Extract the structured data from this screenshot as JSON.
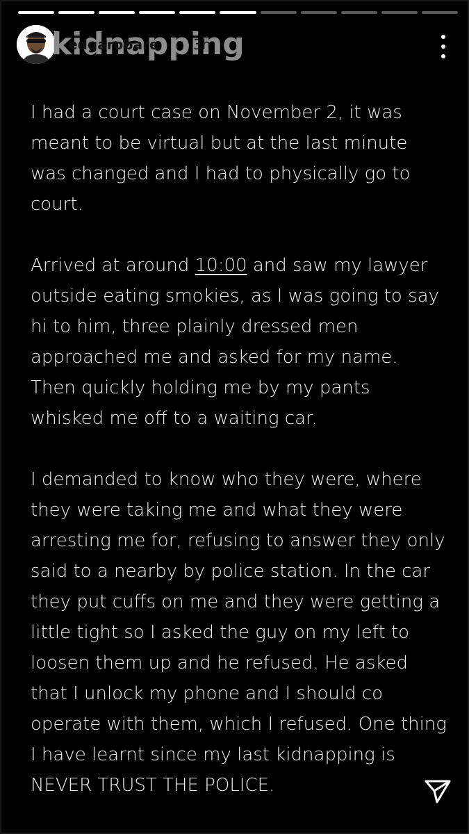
{
  "story": {
    "segment_count": 11,
    "active_segment": 6,
    "background_title": "kidnapping",
    "username": "edgarobare",
    "time_ago": "3h"
  },
  "colors": {
    "background": "#000000",
    "text": "#f0f0f0",
    "progress_done": "#ffffff",
    "progress_pending": "rgba(255,255,255,0.35)"
  },
  "icons": {
    "more": "vertical-dots-icon",
    "send": "paper-plane-icon"
  },
  "content": {
    "p1": "I had a court case on November 2, it was meant to be virtual but at the last minute was changed and I had to physically go to court.",
    "p2_before": "Arrived at around ",
    "p2_time": "10:00",
    "p2_after": " and saw my lawyer outside eating smokies, as I was going to say hi to him, three plainly dressed men approached me and asked for my name. Then quickly holding me by my pants whisked me off to a waiting car.",
    "p3": "I demanded to know who they were, where they were taking me and what they were arresting me for, refusing to answer they only said to a nearby by police station. In the car they put cuffs on me and they were getting a little tight so I asked the guy on my left to loosen them up and he refused. He asked that I unlock my phone and I should co operate with them, which I refused. One thing I have learnt since my last kidnapping is NEVER TRUST THE POLICE."
  }
}
